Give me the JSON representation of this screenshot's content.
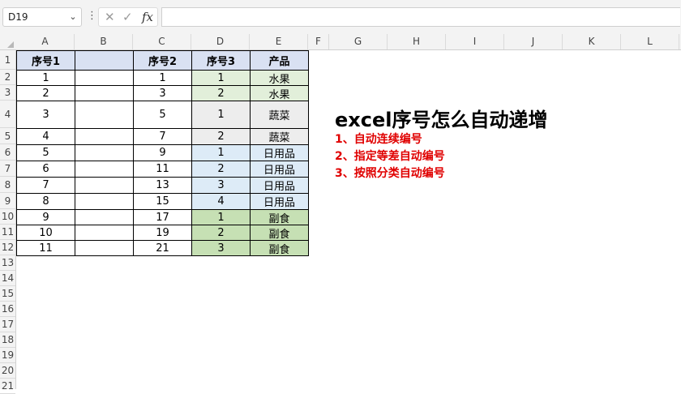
{
  "name_box": {
    "value": "D19"
  },
  "formula_bar": {
    "fx_label": "fx",
    "cancel_symbol": "✕",
    "enter_symbol": "✓",
    "value": ""
  },
  "columns": [
    "A",
    "B",
    "C",
    "D",
    "E",
    "F",
    "G",
    "H",
    "I",
    "J",
    "K",
    "L"
  ],
  "rows": [
    "1",
    "2",
    "3",
    "4",
    "5",
    "6",
    "7",
    "8",
    "9",
    "10",
    "11",
    "12",
    "13",
    "14",
    "15",
    "16",
    "17",
    "18",
    "19",
    "20",
    "21"
  ],
  "table": {
    "headers": {
      "a": "序号1",
      "b": "",
      "c": "序号2",
      "d": "序号3",
      "e": "产品"
    },
    "rows": [
      {
        "a": "1",
        "b": "",
        "c": "1",
        "d": "1",
        "e": "水果"
      },
      {
        "a": "2",
        "b": "",
        "c": "3",
        "d": "2",
        "e": "水果"
      },
      {
        "a": "3",
        "b": "",
        "c": "5",
        "d": "1",
        "e": "蔬菜"
      },
      {
        "a": "4",
        "b": "",
        "c": "7",
        "d": "2",
        "e": "蔬菜"
      },
      {
        "a": "5",
        "b": "",
        "c": "9",
        "d": "1",
        "e": "日用品"
      },
      {
        "a": "6",
        "b": "",
        "c": "11",
        "d": "2",
        "e": "日用品"
      },
      {
        "a": "7",
        "b": "",
        "c": "13",
        "d": "3",
        "e": "日用品"
      },
      {
        "a": "8",
        "b": "",
        "c": "15",
        "d": "4",
        "e": "日用品"
      },
      {
        "a": "9",
        "b": "",
        "c": "17",
        "d": "1",
        "e": "副食"
      },
      {
        "a": "10",
        "b": "",
        "c": "19",
        "d": "2",
        "e": "副食"
      },
      {
        "a": "11",
        "b": "",
        "c": "21",
        "d": "3",
        "e": "副食"
      }
    ]
  },
  "title_text": "excel序号怎么自动递增",
  "notes": [
    "1、自动连续编号",
    "2、指定等差自动编号",
    "3、按照分类自动编号"
  ],
  "colors": {
    "header_fill": "#d9e1f2",
    "fruit_fill": "#e2efda",
    "veg_fill": "#ededed",
    "daily_fill": "#ddebf7",
    "food_fill": "#c6e0b4",
    "note_color": "#e00000"
  }
}
